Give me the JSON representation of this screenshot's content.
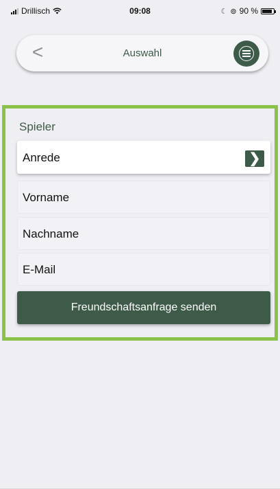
{
  "status_bar": {
    "carrier": "Drillisch",
    "time": "09:08",
    "battery": "90 %",
    "battery_level": 0.9
  },
  "header": {
    "title": "Auswahl",
    "back_glyph": "<",
    "back_icon": "chevron-left-icon",
    "menu_icon": "hamburger-menu-icon"
  },
  "form": {
    "section_title": "Spieler",
    "fields": [
      {
        "label": "Anrede",
        "has_chevron": true
      },
      {
        "label": "Vorname"
      },
      {
        "label": "Nachname"
      },
      {
        "label": "E-Mail"
      }
    ],
    "submit_label": "Freundschaftsanfrage senden",
    "chevron_glyph": "❯"
  },
  "colors": {
    "accent": "#3d5b48",
    "highlight_border": "#8bc34a",
    "background": "#efeef3"
  }
}
